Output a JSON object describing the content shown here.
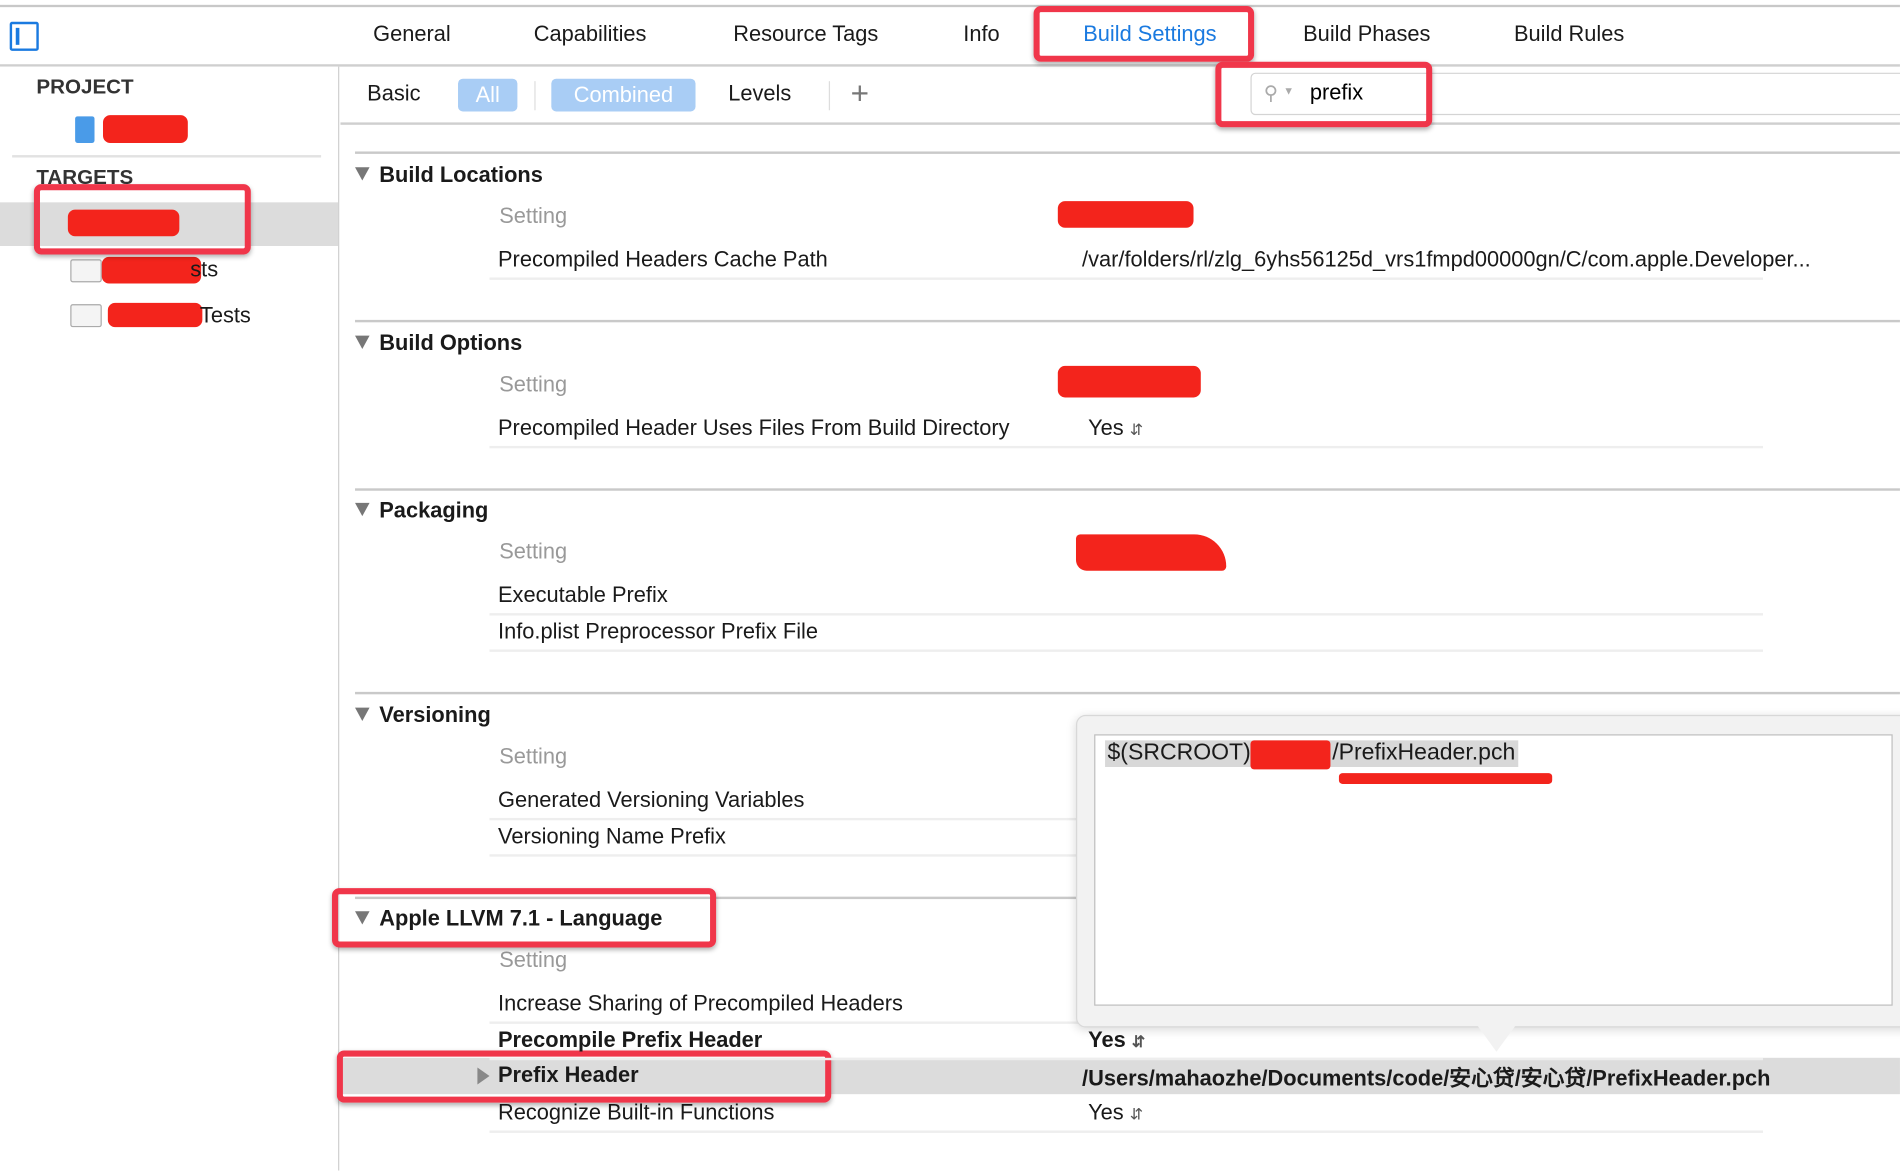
{
  "tabs": [
    {
      "label": "General",
      "active": false
    },
    {
      "label": "Capabilities",
      "active": false
    },
    {
      "label": "Resource Tags",
      "active": false
    },
    {
      "label": "Info",
      "active": false
    },
    {
      "label": "Build Settings",
      "active": true
    },
    {
      "label": "Build Phases",
      "active": false
    },
    {
      "label": "Build Rules",
      "active": false
    }
  ],
  "sidebar": {
    "project_header": "PROJECT",
    "targets_header": "TARGETS",
    "targets": [
      {
        "label_suffix": "",
        "selected": true
      },
      {
        "label_suffix": "sts",
        "selected": false
      },
      {
        "label_suffix": "Tests",
        "selected": false
      }
    ]
  },
  "filterbar": {
    "basic": "Basic",
    "all": "All",
    "combined": "Combined",
    "levels": "Levels",
    "add": "+",
    "search_value": "prefix"
  },
  "setting_header": "Setting",
  "sections": [
    {
      "title": "Build Locations",
      "rows": [
        {
          "name": "Precompiled Headers Cache Path",
          "value": "/var/folders/rl/zlg_6yhs56125d_vrs1fmpd00000gn/C/com.apple.Developer..."
        }
      ]
    },
    {
      "title": "Build Options",
      "rows": [
        {
          "name": "Precompiled Header Uses Files From Build Directory",
          "value": "Yes"
        }
      ]
    },
    {
      "title": "Packaging",
      "rows": [
        {
          "name": "Executable Prefix",
          "value": ""
        },
        {
          "name": "Info.plist Preprocessor Prefix File",
          "value": ""
        }
      ]
    },
    {
      "title": "Versioning",
      "rows": [
        {
          "name": "Generated Versioning Variables",
          "value": ""
        },
        {
          "name": "Versioning Name Prefix",
          "value": ""
        }
      ]
    },
    {
      "title": "Apple LLVM 7.1 - Language",
      "rows": [
        {
          "name": "Increase Sharing of Precompiled Headers",
          "value": ""
        },
        {
          "name": "Precompile Prefix Header",
          "value": "Yes"
        },
        {
          "name": "Prefix Header",
          "value": "/Users/mahaozhe/Documents/code/安心贷/安心贷/PrefixHeader.pch"
        },
        {
          "name": "Recognize Built-in Functions",
          "value": "Yes"
        }
      ]
    }
  ],
  "popover": {
    "text_start": "$(SRCROOT)/",
    "text_end": "/PrefixHeader.pch"
  },
  "colors": {
    "accent": "#1a7ae0",
    "annotation": "#f0364a",
    "redaction": "#f3241c"
  }
}
